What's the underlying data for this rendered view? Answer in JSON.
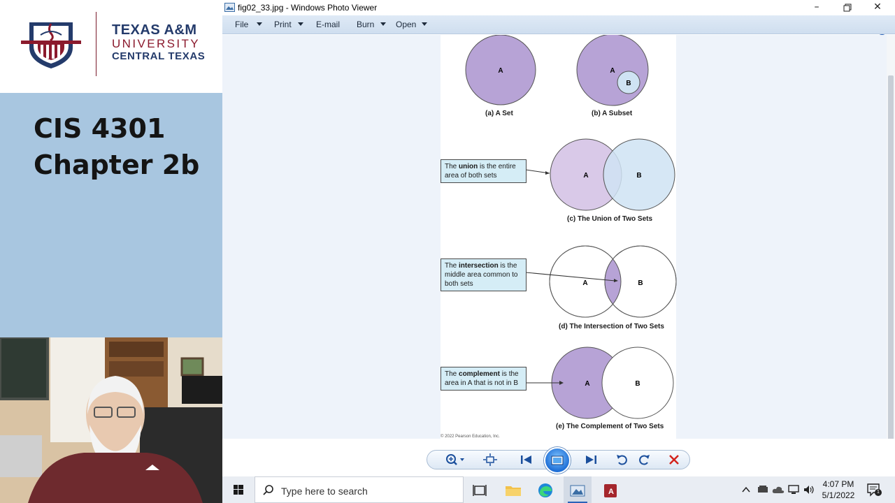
{
  "slide": {
    "university_line1": "TEXAS A&M",
    "university_line2": "UNIVERSITY",
    "university_line3": "CENTRAL TEXAS",
    "title_line1": "CIS 4301",
    "title_line2": "Chapter 2b"
  },
  "window": {
    "title": "fig02_33.jpg - Windows Photo Viewer",
    "minimize_icon": "minimize-icon",
    "restore_icon": "restore-icon",
    "close_icon": "close-icon",
    "menu": [
      {
        "label": "File",
        "has_dropdown": true
      },
      {
        "label": "Print",
        "has_dropdown": true
      },
      {
        "label": "E-mail",
        "has_dropdown": false
      },
      {
        "label": "Burn",
        "has_dropdown": true
      },
      {
        "label": "Open",
        "has_dropdown": true
      }
    ],
    "help_label": "?"
  },
  "figure": {
    "a": {
      "caption": "(a) A Set",
      "set_a": "A"
    },
    "b": {
      "caption": "(b) A Subset",
      "set_a": "A",
      "set_b": "B"
    },
    "c": {
      "caption": "(c) The Union of Two Sets",
      "set_a": "A",
      "set_b": "B",
      "callout_pre": "The ",
      "callout_bold": "union",
      "callout_post": " is the entire area of both sets"
    },
    "d": {
      "caption": "(d) The Intersection of Two Sets",
      "set_a": "A",
      "set_b": "B",
      "callout_pre": "The ",
      "callout_bold": "intersection",
      "callout_post": " is the middle area common to both sets"
    },
    "e": {
      "caption": "(e) The Complement of Two Sets",
      "set_a": "A",
      "set_b": "B",
      "callout_pre": "The ",
      "callout_bold": "complement",
      "callout_post": " is the area in A that is not in B"
    },
    "copyright": "© 2022 Pearson Education, Inc.",
    "colors": {
      "purple": "#b7a3d6",
      "light_purple": "#d9c9e8",
      "light_blue": "#cfe3f3",
      "callout_bg": "#d5edf6"
    }
  },
  "photo_toolbar": {
    "icons": [
      "zoom-icon",
      "actual-size-icon",
      "previous-icon",
      "slideshow-icon",
      "next-icon",
      "rotate-left-icon",
      "rotate-right-icon",
      "delete-icon"
    ]
  },
  "taskbar": {
    "search_placeholder": "Type here to search",
    "time": "4:07 PM",
    "date": "5/1/2022",
    "notification_count": "1"
  }
}
